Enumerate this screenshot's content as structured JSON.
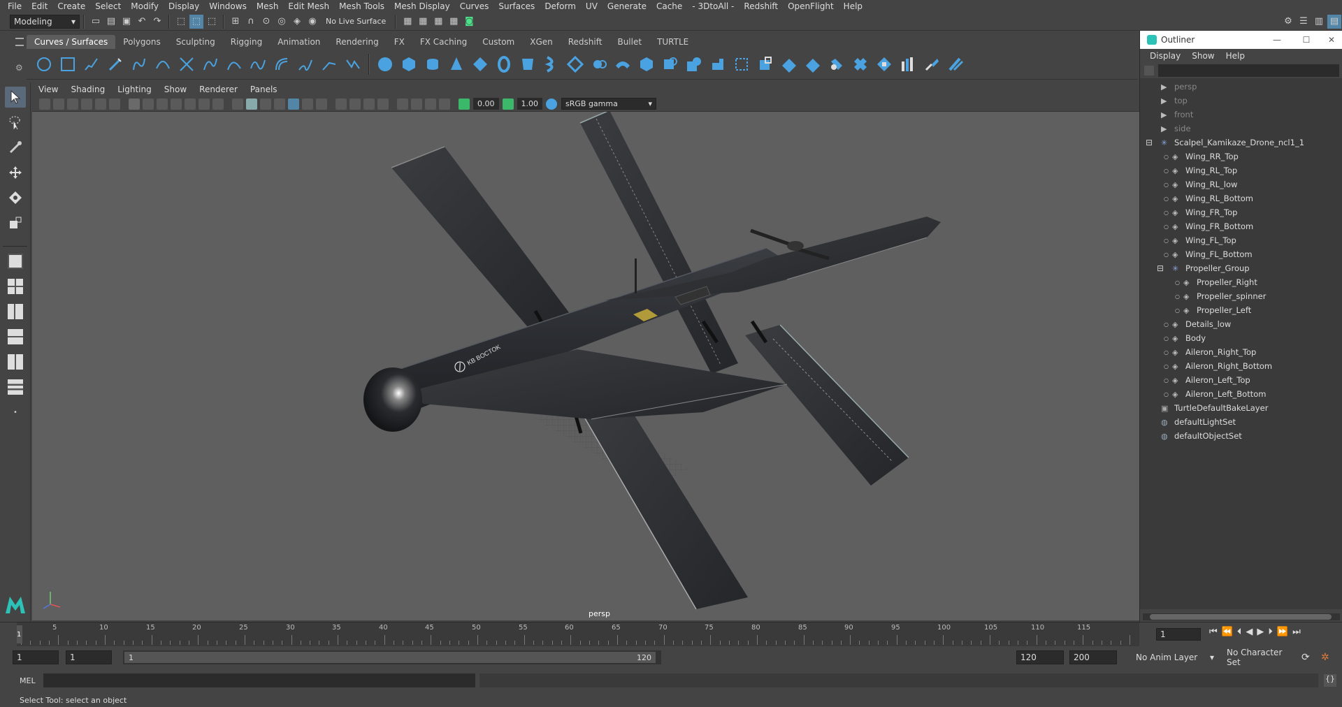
{
  "menubar": [
    "File",
    "Edit",
    "Create",
    "Select",
    "Modify",
    "Display",
    "Windows",
    "Mesh",
    "Edit Mesh",
    "Mesh Tools",
    "Mesh Display",
    "Curves",
    "Surfaces",
    "Deform",
    "UV",
    "Generate",
    "Cache",
    "- 3DtoAll -",
    "Redshift",
    "OpenFlight",
    "Help"
  ],
  "status": {
    "mode": "Modeling",
    "live_surface": "No Live Surface"
  },
  "shelf_tabs": [
    "Curves / Surfaces",
    "Polygons",
    "Sculpting",
    "Rigging",
    "Animation",
    "Rendering",
    "FX",
    "FX Caching",
    "Custom",
    "XGen",
    "Redshift",
    "Bullet",
    "TURTLE"
  ],
  "panel_menu": [
    "View",
    "Shading",
    "Lighting",
    "Show",
    "Renderer",
    "Panels"
  ],
  "panel_toolbar": {
    "exposure": "0.00",
    "gamma": "1.00",
    "color_space": "sRGB gamma"
  },
  "viewport": {
    "camera_label": "persp",
    "decal": "KB BOCTOK"
  },
  "outliner": {
    "title": "Outliner",
    "menu": [
      "Display",
      "Show",
      "Help"
    ],
    "items": [
      {
        "label": "persp",
        "indent": 0,
        "kind": "camera",
        "dim": true
      },
      {
        "label": "top",
        "indent": 0,
        "kind": "camera",
        "dim": true
      },
      {
        "label": "front",
        "indent": 0,
        "kind": "camera",
        "dim": true
      },
      {
        "label": "side",
        "indent": 0,
        "kind": "camera",
        "dim": true
      },
      {
        "label": "Scalpel_Kamikaze_Drone_ncl1_1",
        "indent": 0,
        "kind": "group",
        "expanded": true
      },
      {
        "label": "Wing_RR_Top",
        "indent": 1,
        "kind": "mesh"
      },
      {
        "label": "Wing_RL_Top",
        "indent": 1,
        "kind": "mesh"
      },
      {
        "label": "Wing_RL_low",
        "indent": 1,
        "kind": "mesh"
      },
      {
        "label": "Wing_RL_Bottom",
        "indent": 1,
        "kind": "mesh"
      },
      {
        "label": "Wing_FR_Top",
        "indent": 1,
        "kind": "mesh"
      },
      {
        "label": "Wing_FR_Bottom",
        "indent": 1,
        "kind": "mesh"
      },
      {
        "label": "Wing_FL_Top",
        "indent": 1,
        "kind": "mesh"
      },
      {
        "label": "Wing_FL_Bottom",
        "indent": 1,
        "kind": "mesh"
      },
      {
        "label": "Propeller_Group",
        "indent": 1,
        "kind": "group",
        "expanded": true
      },
      {
        "label": "Propeller_Right",
        "indent": 2,
        "kind": "mesh"
      },
      {
        "label": "Propeller_spinner",
        "indent": 2,
        "kind": "mesh"
      },
      {
        "label": "Propeller_Left",
        "indent": 2,
        "kind": "mesh"
      },
      {
        "label": "Details_low",
        "indent": 1,
        "kind": "mesh"
      },
      {
        "label": "Body",
        "indent": 1,
        "kind": "mesh"
      },
      {
        "label": "Aileron_Right_Top",
        "indent": 1,
        "kind": "mesh"
      },
      {
        "label": "Aileron_Right_Bottom",
        "indent": 1,
        "kind": "mesh"
      },
      {
        "label": "Aileron_Left_Top",
        "indent": 1,
        "kind": "mesh"
      },
      {
        "label": "Aileron_Left_Bottom",
        "indent": 1,
        "kind": "mesh"
      },
      {
        "label": "TurtleDefaultBakeLayer",
        "indent": 0,
        "kind": "layer"
      },
      {
        "label": "defaultLightSet",
        "indent": 0,
        "kind": "set"
      },
      {
        "label": "defaultObjectSet",
        "indent": 0,
        "kind": "set"
      }
    ]
  },
  "timeline": {
    "ticks": [
      "5",
      "10",
      "15",
      "20",
      "25",
      "30",
      "35",
      "40",
      "45",
      "50",
      "55",
      "60",
      "65",
      "70",
      "75",
      "80",
      "85",
      "90",
      "95",
      "100",
      "105",
      "110",
      "115"
    ],
    "start_marker": "1",
    "current_frame": "1"
  },
  "range": {
    "start": "1",
    "playback_start": "1",
    "range_start": "1",
    "range_end": "120",
    "playback_end": "120",
    "end": "200",
    "anim_layer": "No Anim Layer",
    "character_set": "No Character Set"
  },
  "cmd": {
    "label": "MEL"
  },
  "help_text": "Select Tool: select an object",
  "colors": {
    "viewport_bg": "#5f5f5f",
    "drone": "#2a2c2f",
    "accent": "#5285a6",
    "shelf_blue": "#4aa3e0"
  }
}
